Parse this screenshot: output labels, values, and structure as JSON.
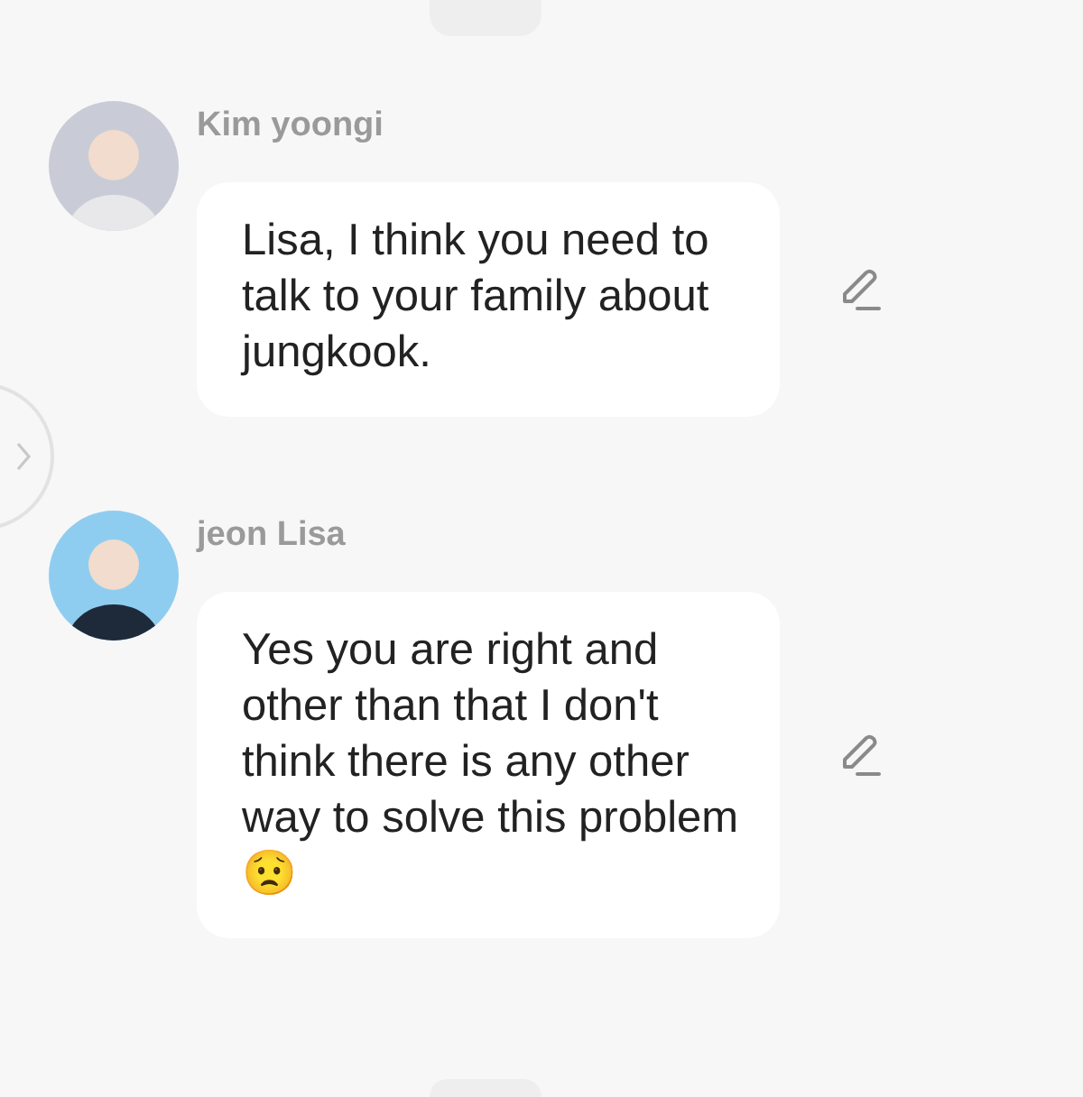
{
  "messages": [
    {
      "sender": "Kim yoongi",
      "text": "Lisa, I think you need to talk to your family about jungkook."
    },
    {
      "sender": "jeon Lisa",
      "text": "Yes you are right and other than that I don't think there is any other way to solve this problem 😟"
    }
  ]
}
